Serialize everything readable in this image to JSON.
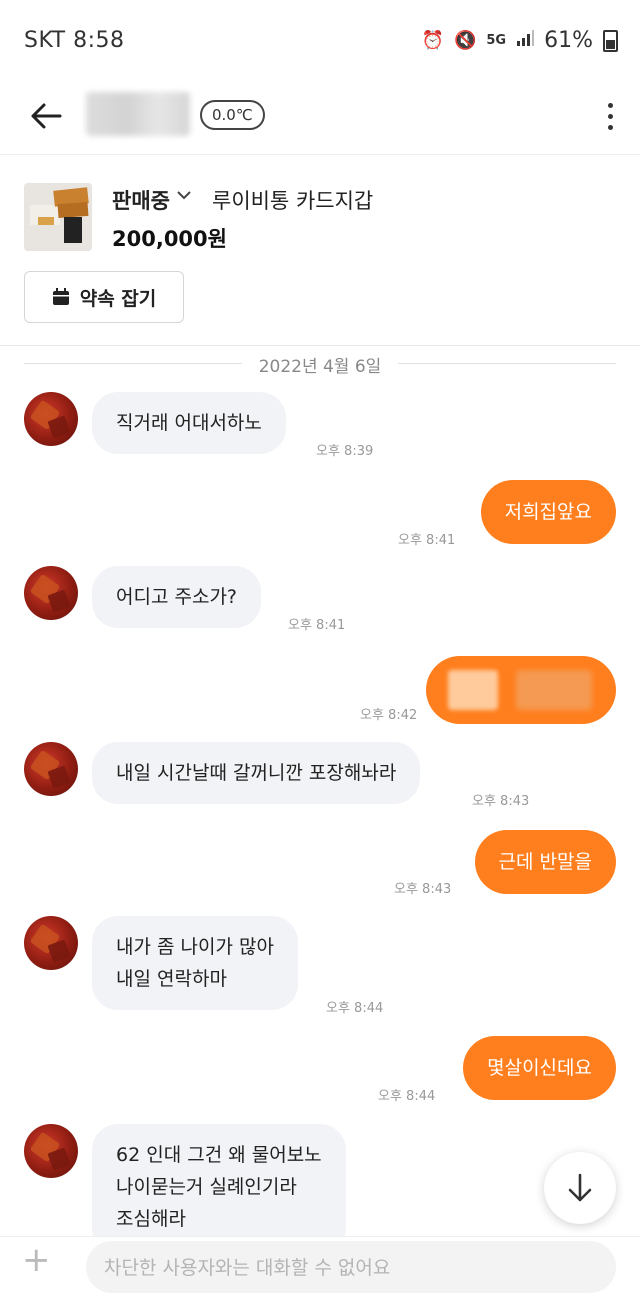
{
  "status_bar": {
    "carrier_time": "SKT 8:58",
    "network": "5G",
    "battery": "61%",
    "icons": [
      "alarm-icon",
      "mute-icon",
      "5g-icon",
      "signal-icon",
      "battery-icon"
    ]
  },
  "header": {
    "back_icon": "arrow-left-icon",
    "temperature": "0.0℃",
    "more_icon": "more-vertical-icon"
  },
  "product": {
    "status": "판매중",
    "title": "루이비통 카드지갑",
    "price": "200,000원",
    "appointment_label": "약속 잡기"
  },
  "chat": {
    "date": "2022년 4월 6일",
    "messages": [
      {
        "from": "other",
        "text": "직거래 어대서하노",
        "time": "오후 8:39"
      },
      {
        "from": "me",
        "text": "저희집앞요",
        "time": "오후 8:41"
      },
      {
        "from": "other",
        "text": "어디고 주소가?",
        "time": "오후 8:41"
      },
      {
        "from": "me",
        "text": "",
        "time": "오후 8:42"
      },
      {
        "from": "other",
        "text": "내일 시간날때 갈꺼니깐 포장해놔라",
        "time": "오후 8:43"
      },
      {
        "from": "me",
        "text": "근데 반말을",
        "time": "오후 8:43"
      },
      {
        "from": "other",
        "lines": [
          "내가 좀 나이가 많아",
          "내일 연락하마"
        ],
        "time": "오후 8:44"
      },
      {
        "from": "me",
        "text": "몇살이신데요",
        "time": "오후 8:44"
      },
      {
        "from": "other",
        "lines": [
          "62 인대 그건 왜 물어보노",
          "나이묻는거 실례인기라",
          "조심해라"
        ],
        "time": ""
      }
    ]
  },
  "input": {
    "placeholder": "차단한 사용자와는 대화할 수 없어요"
  },
  "colors": {
    "accent": "#ff7e1d",
    "incoming_bubble": "#f2f3f6",
    "time_text": "#999999"
  }
}
